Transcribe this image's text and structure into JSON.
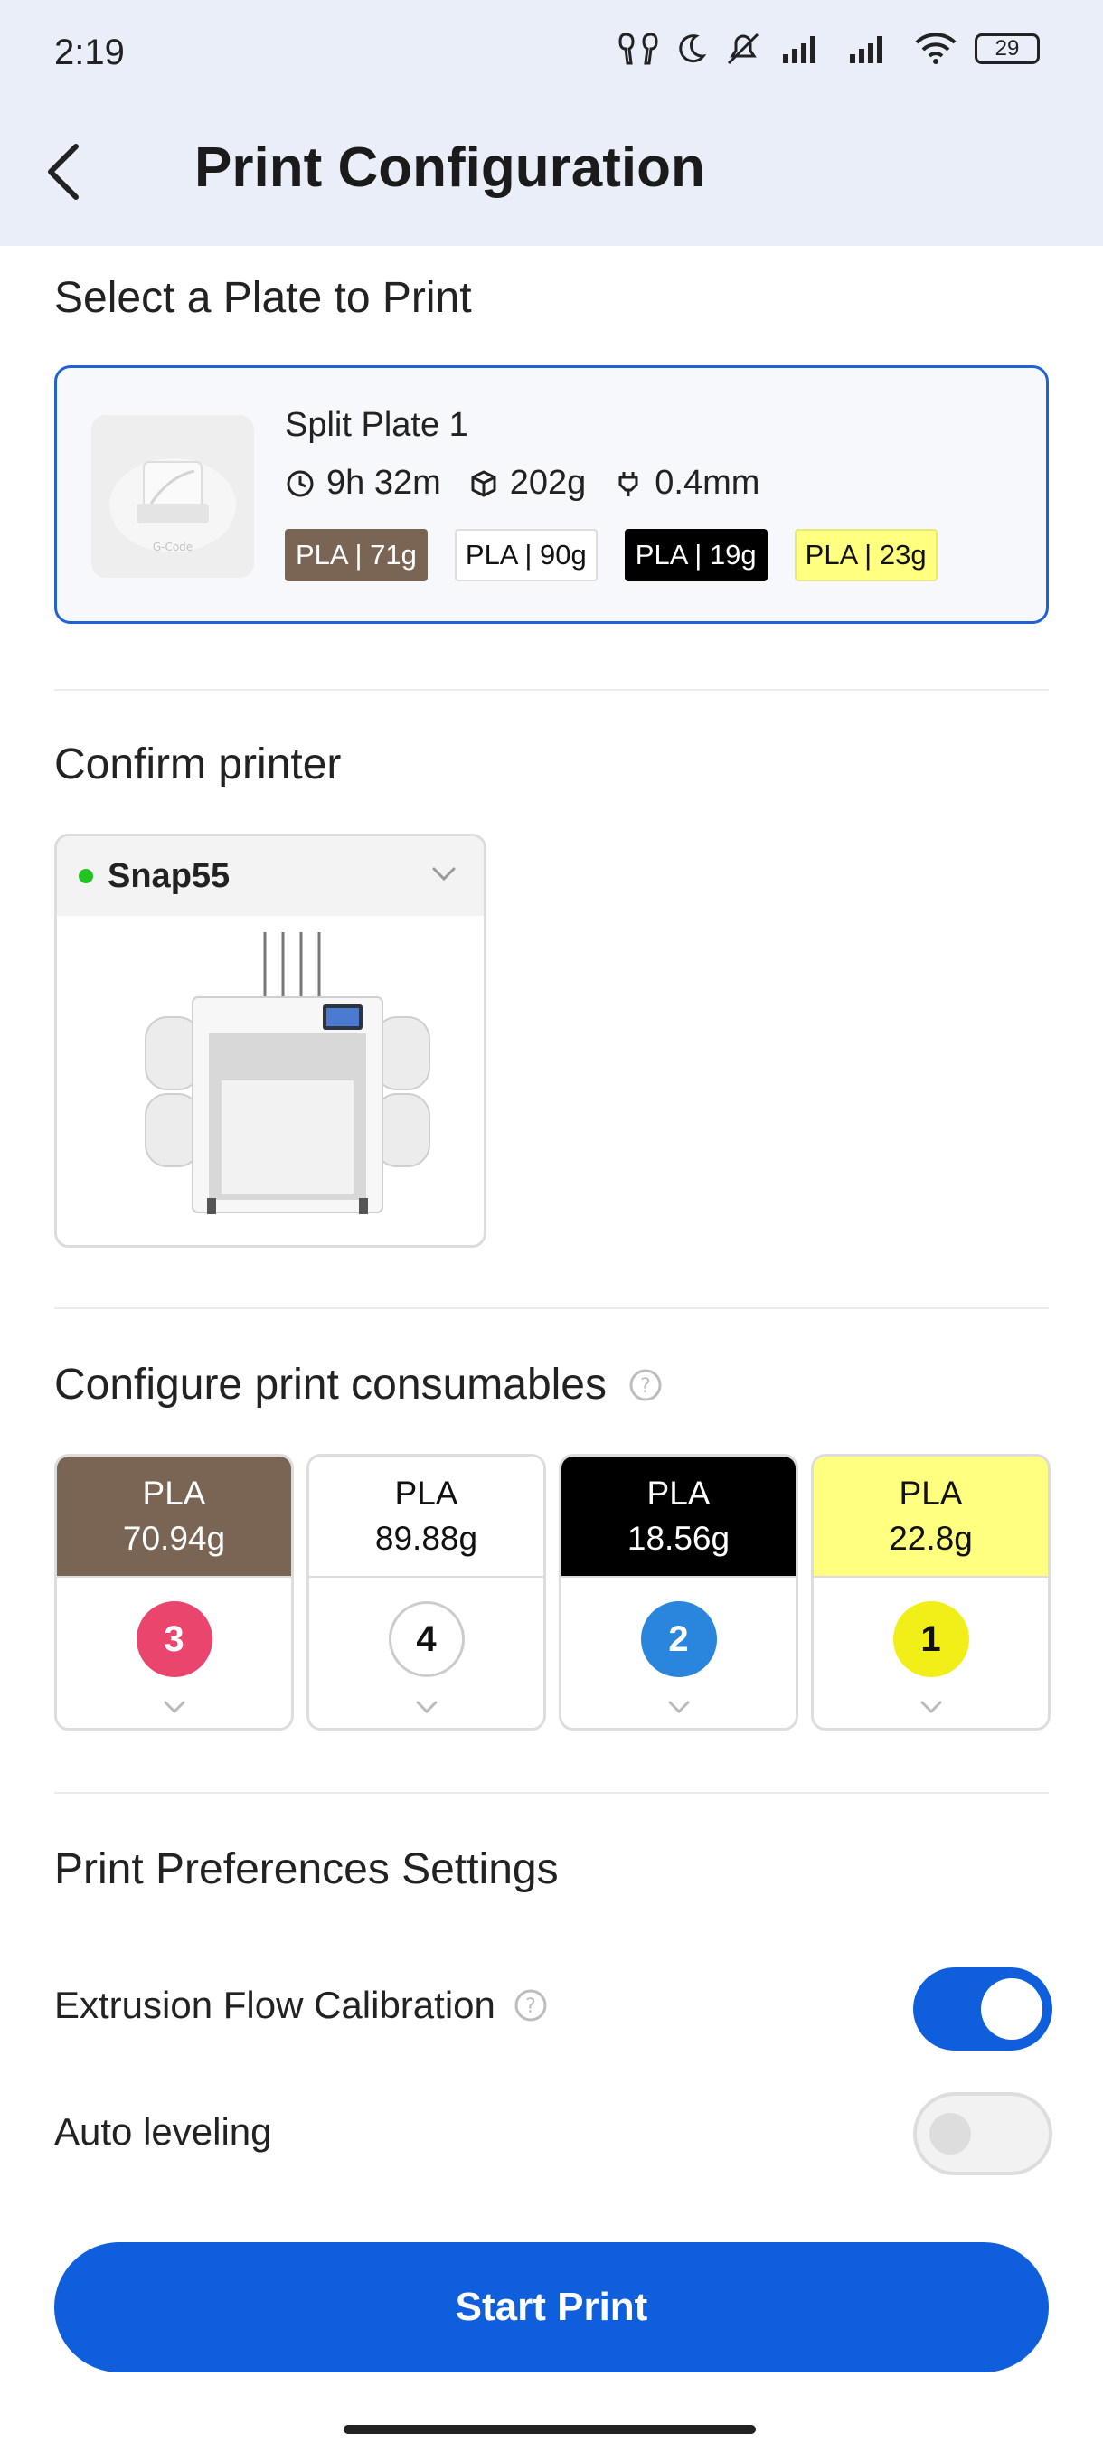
{
  "status_bar": {
    "time": "2:19",
    "battery": "29"
  },
  "header": {
    "title": "Print Configuration"
  },
  "plate_section": {
    "title": "Select a Plate to Print",
    "plate": {
      "name": "Split Plate 1",
      "thumb_caption": "G-Code",
      "time": "9h 32m",
      "weight": "202g",
      "nozzle": "0.4mm",
      "chips": [
        {
          "label": "PLA | 71g",
          "bg": "#7a6454",
          "fg": "#ffffff",
          "border": "#7a6454"
        },
        {
          "label": "PLA | 90g",
          "bg": "#ffffff",
          "fg": "#111111",
          "border": "#dddddd"
        },
        {
          "label": "PLA | 19g",
          "bg": "#000000",
          "fg": "#ffffff",
          "border": "#000000"
        },
        {
          "label": "PLA | 23g",
          "bg": "#ffff80",
          "fg": "#111111",
          "border": "#e8e87a"
        }
      ]
    }
  },
  "printer_section": {
    "title": "Confirm printer",
    "printer": {
      "name": "Snap55",
      "status_color": "#22c322"
    }
  },
  "consumables_section": {
    "title": "Configure print consumables",
    "items": [
      {
        "material": "PLA",
        "weight": "70.94g",
        "bg": "#7a6454",
        "fg": "#ffffff",
        "slot": "3",
        "slot_bg": "#e9456d",
        "slot_fg": "#ffffff",
        "slot_border": "#e9456d"
      },
      {
        "material": "PLA",
        "weight": "89.88g",
        "bg": "#ffffff",
        "fg": "#111111",
        "slot": "4",
        "slot_bg": "#ffffff",
        "slot_fg": "#111111",
        "slot_border": "#cccccc"
      },
      {
        "material": "PLA",
        "weight": "18.56g",
        "bg": "#000000",
        "fg": "#ffffff",
        "slot": "2",
        "slot_bg": "#2a86dc",
        "slot_fg": "#ffffff",
        "slot_border": "#2a86dc"
      },
      {
        "material": "PLA",
        "weight": "22.8g",
        "bg": "#ffff80",
        "fg": "#111111",
        "slot": "1",
        "slot_bg": "#f2ef18",
        "slot_fg": "#111111",
        "slot_border": "#f2ef18"
      }
    ]
  },
  "preferences_section": {
    "title": "Print Preferences Settings",
    "extrusion_label": "Extrusion Flow Calibration",
    "extrusion_on": true,
    "leveling_label": "Auto leveling",
    "leveling_on": false
  },
  "actions": {
    "start_label": "Start Print"
  },
  "colors": {
    "accent": "#0f5fdc"
  }
}
